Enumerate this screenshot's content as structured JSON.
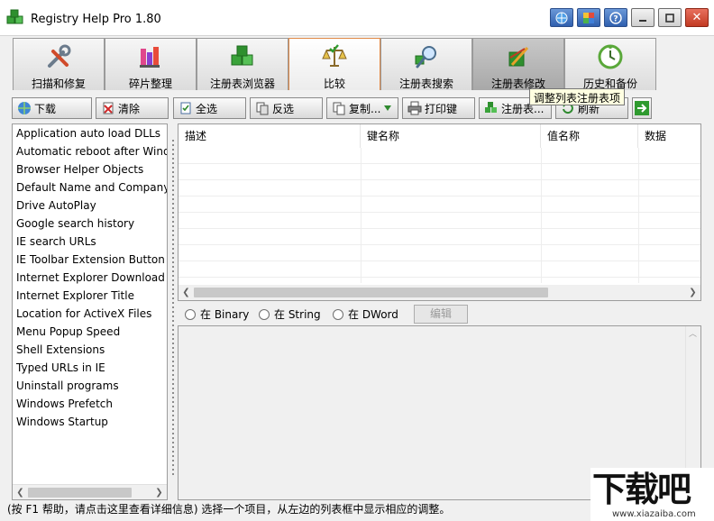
{
  "window": {
    "title": "Registry Help Pro 1.80",
    "close_label": "✕"
  },
  "tabs": [
    {
      "label": "扫描和修复",
      "icon": "wrench-screwdriver-icon"
    },
    {
      "label": "碎片整理",
      "icon": "defrag-blocks-icon"
    },
    {
      "label": "注册表浏览器",
      "icon": "registry-cubes-icon"
    },
    {
      "label": "比较",
      "icon": "balance-scale-icon"
    },
    {
      "label": "注册表搜索",
      "icon": "magnifier-icon"
    },
    {
      "label": "注册表修改",
      "icon": "registry-edit-icon"
    },
    {
      "label": "历史和备份",
      "icon": "clock-history-icon"
    }
  ],
  "toolbar": {
    "download": "下载",
    "clear": "清除",
    "select_all": "全选",
    "invert": "反选",
    "copy": "复制...",
    "print": "打印键",
    "registry": "注册表...",
    "refresh": "刷新",
    "tooltip": "调整列表注册表项"
  },
  "tweak_list": [
    "Application auto load DLLs",
    "Automatic reboot after Windows",
    "Browser Helper Objects",
    "Default Name and Company Info",
    "Drive AutoPlay",
    "Google search history",
    "IE search URLs",
    "IE Toolbar Extension Button",
    "Internet Explorer Download N",
    "Internet Explorer Title",
    "Location for ActiveX Files",
    "Menu Popup Speed",
    "Shell Extensions",
    "Typed URLs in IE",
    "Uninstall programs",
    "Windows Prefetch",
    "Windows Startup"
  ],
  "grid": {
    "columns": [
      "描述",
      "键名称",
      "值名称",
      "数据"
    ]
  },
  "value_types": {
    "binary": "在 Binary",
    "string": "在 String",
    "dword": "在 DWord",
    "edit_button": "编辑"
  },
  "status": {
    "text": "(按 F1 帮助，请点击这里查看详细信息) 选择一个项目，从左边的列表框中显示相应的调整。"
  },
  "watermark": {
    "brand": "下载吧",
    "url": "www.xiazaiba.com"
  }
}
